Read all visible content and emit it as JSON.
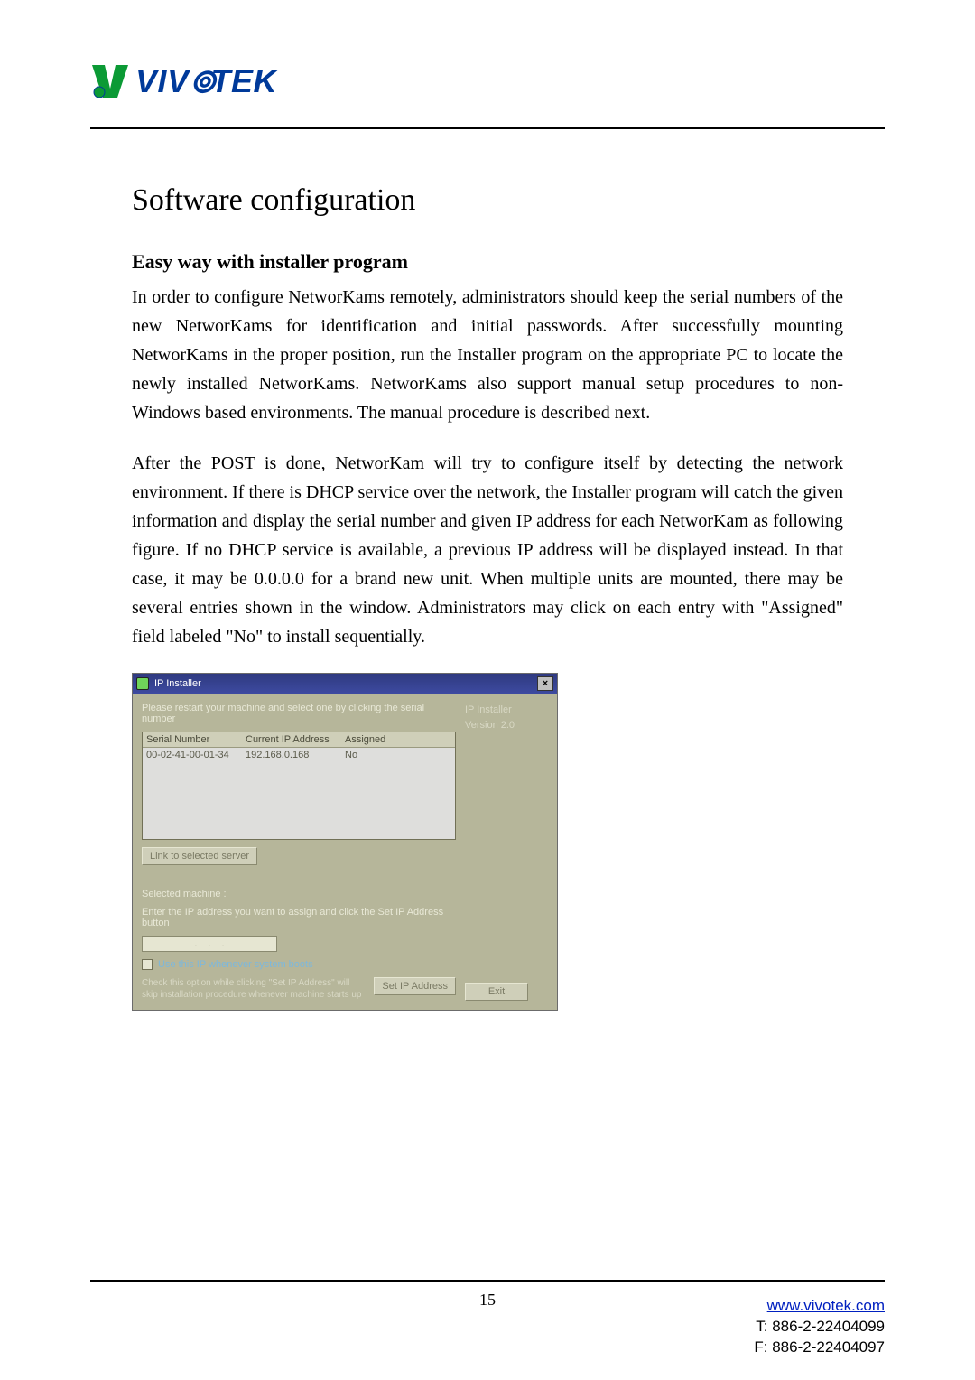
{
  "brand": {
    "name_html": "VIVOTEK"
  },
  "heading": "Software configuration",
  "subheading": "Easy way with installer program",
  "para1": "In order to configure NetworKams remotely, administrators should keep the serial numbers of the new NetworKams for identification and initial passwords. After successfully mounting NetworKams in the proper position, run the Installer program on the appropriate PC to locate the newly installed NetworKams. NetworKams also support manual setup procedures to non-Windows based environments. The manual procedure is described next.",
  "para2": "After the POST is done, NetworKam will try to configure itself by detecting the network environment. If there is DHCP service over the network, the Installer program will catch the given information and display the serial number and given IP address for each NetworKam as following figure. If no DHCP service is available, a previous IP address will be displayed instead. In that case, it may be 0.0.0.0 for a brand new unit. When multiple units are mounted, there may be several entries shown in the window. Administrators may click on each entry with \"Assigned\" field labeled \"No\" to install sequentially.",
  "installer": {
    "title": "IP Installer",
    "app_name": "IP Installer",
    "version": "Version 2.0",
    "instruction_top": "Please restart your machine and select one by clicking the serial number",
    "columns": {
      "c1": "Serial Number",
      "c2": "Current IP Address",
      "c3": "Assigned"
    },
    "row": {
      "serial": "00-02-41-00-01-34",
      "ip": "192.168.0.168",
      "assigned": "No"
    },
    "link_btn": "Link to selected server",
    "selected_label": "Selected machine :",
    "instruction_ip": "Enter the IP address you want to assign and click the Set IP Address button",
    "ip_sep": ".",
    "checkbox_label": "Use this IP whenever system boots",
    "check_desc": "Check this option while clicking \"Set IP Address\" will skip installation procedure whenever machine starts up",
    "set_btn": "Set IP Address",
    "exit_btn": "Exit"
  },
  "page_number": "15",
  "footer": {
    "url": "www.vivotek.com",
    "tel": "T: 886-2-22404099",
    "fax": "F: 886-2-22404097"
  }
}
